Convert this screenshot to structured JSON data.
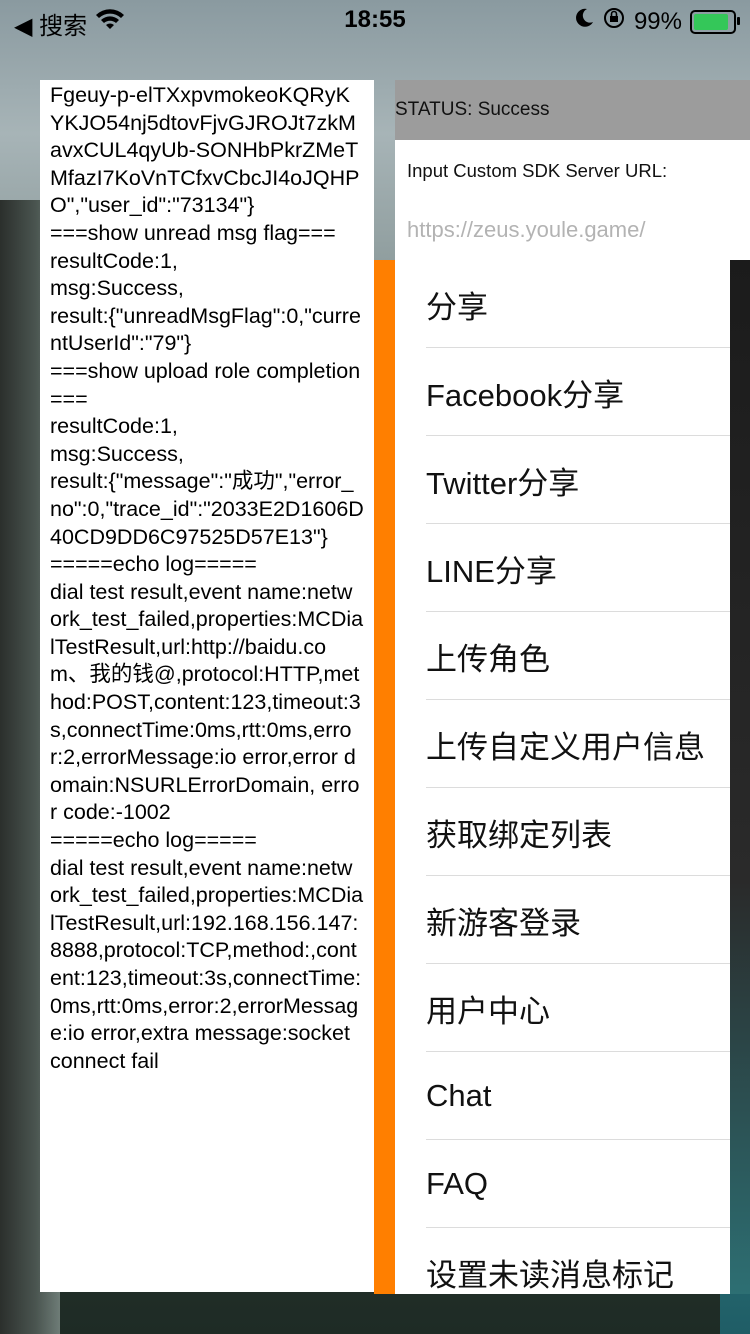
{
  "statusbar": {
    "back_label": "◀ 搜索",
    "time": "18:55",
    "battery_percent": "99%"
  },
  "status": {
    "text": "STATUS: Success"
  },
  "server": {
    "label": "Input Custom SDK Server URL:",
    "placeholder": "https://zeus.youle.game/"
  },
  "log": {
    "text": "Fgeuy-p-elTXxpvmokeoKQRyKYKJO54nj5dtovFjvGJROJt7zkMavxCUL4qyUb-SONHbPkrZMeTMfazI7KoVnTCfxvCbcJI4oJQHPO\",\"user_id\":\"73134\"}\n===show unread msg flag===\nresultCode:1,\nmsg:Success,\nresult:{\"unreadMsgFlag\":0,\"currentUserId\":\"79\"}\n===show upload role completion===\nresultCode:1,\nmsg:Success,\nresult:{\"message\":\"成功\",\"error_no\":0,\"trace_id\":\"2033E2D1606D40CD9DD6C97525D57E13\"}\n=====echo log=====\ndial test result,event name:network_test_failed,properties:MCDialTestResult,url:http://baidu.com、我的钱@,protocol:HTTP,method:POST,content:123,timeout:3s,connectTime:0ms,rtt:0ms,error:2,errorMessage:io error,error domain:NSURLErrorDomain, error code:-1002\n=====echo log=====\ndial test result,event name:network_test_failed,properties:MCDialTestResult,url:192.168.156.147:8888,protocol:TCP,method:,content:123,timeout:3s,connectTime:0ms,rtt:0ms,error:2,errorMessage:io error,extra message:socket connect fail"
  },
  "menu": {
    "items": [
      {
        "label": "分享"
      },
      {
        "label": "Facebook分享"
      },
      {
        "label": "Twitter分享"
      },
      {
        "label": "LINE分享"
      },
      {
        "label": "上传角色"
      },
      {
        "label": "上传自定义用户信息"
      },
      {
        "label": "获取绑定列表"
      },
      {
        "label": "新游客登录"
      },
      {
        "label": "用户中心"
      },
      {
        "label": "Chat"
      },
      {
        "label": "FAQ"
      },
      {
        "label": "设置未读消息标记"
      }
    ]
  },
  "colors": {
    "accent_bar": "#ff7f00",
    "status_header_bg": "#9c9c9c",
    "battery_fill": "#34c759"
  }
}
